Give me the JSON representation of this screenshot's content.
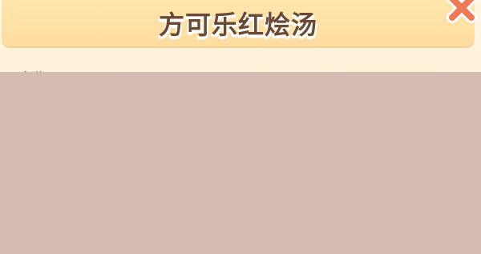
{
  "dialog": {
    "title": "方可乐红烩汤",
    "left_label": "食谱"
  },
  "icons": {
    "close": "close-x-icon"
  },
  "colors": {
    "title_bar": "#ffe0a6",
    "title_text": "#6a4a34",
    "close_button": "#ee7a57",
    "overlay": "#d5bcb0",
    "panel": "#fff4df"
  }
}
